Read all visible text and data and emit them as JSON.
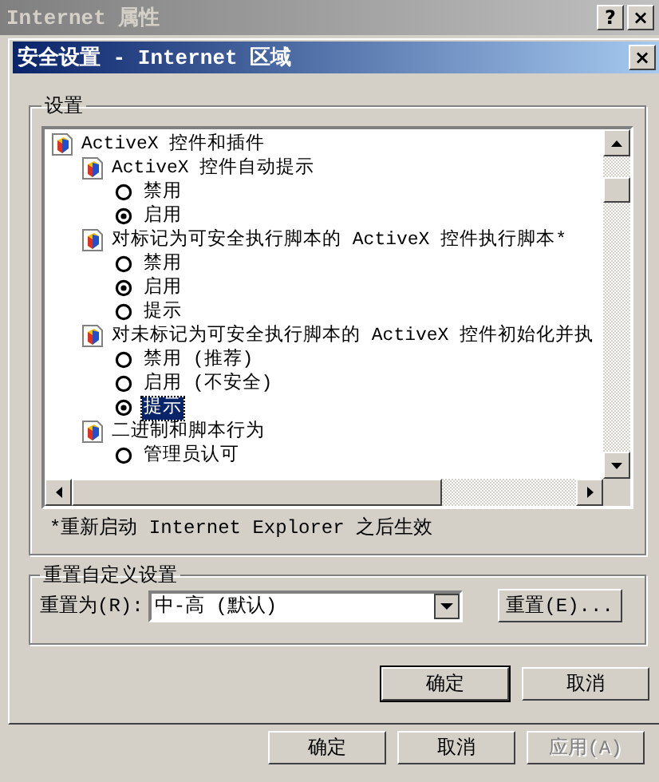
{
  "back_window": {
    "title": "Internet 属性",
    "title_buttons": [
      "?",
      "×"
    ],
    "buttons": [
      {
        "label": "确定",
        "disabled": false
      },
      {
        "label": "取消",
        "disabled": false
      },
      {
        "label": "应用(A)",
        "disabled": true
      }
    ]
  },
  "dialog": {
    "title": "安全设置 - Internet 区域",
    "close": "×"
  },
  "settings": {
    "legend": "设置",
    "tree": [
      {
        "kind": "group",
        "label": "ActiveX 控件和插件",
        "children": [
          {
            "kind": "group",
            "label": "ActiveX 控件自动提示",
            "children": [
              {
                "kind": "radio",
                "label": "禁用",
                "checked": false,
                "selected": false
              },
              {
                "kind": "radio",
                "label": "启用",
                "checked": true,
                "selected": false
              }
            ]
          },
          {
            "kind": "group",
            "label": "对标记为可安全执行脚本的 ActiveX 控件执行脚本*",
            "children": [
              {
                "kind": "radio",
                "label": "禁用",
                "checked": false,
                "selected": false
              },
              {
                "kind": "radio",
                "label": "启用",
                "checked": true,
                "selected": false
              },
              {
                "kind": "radio",
                "label": "提示",
                "checked": false,
                "selected": false
              }
            ]
          },
          {
            "kind": "group",
            "label": "对未标记为可安全执行脚本的 ActiveX 控件初始化并执",
            "children": [
              {
                "kind": "radio",
                "label": "禁用 (推荐)",
                "checked": false,
                "selected": false
              },
              {
                "kind": "radio",
                "label": "启用 (不安全)",
                "checked": false,
                "selected": false
              },
              {
                "kind": "radio",
                "label": "提示",
                "checked": true,
                "selected": true
              }
            ]
          },
          {
            "kind": "group",
            "label": "二进制和脚本行为",
            "children": [
              {
                "kind": "radio",
                "label": "管理员认可",
                "checked": false,
                "selected": false
              }
            ]
          }
        ]
      }
    ],
    "note": "*重新启动 Internet Explorer 之后生效"
  },
  "reset": {
    "legend": "重置自定义设置",
    "label": "重置为(R):",
    "value": "中-高 (默认)",
    "button": "重置(E)..."
  },
  "buttons": [
    {
      "label": "确定",
      "default": true
    },
    {
      "label": "取消",
      "default": false
    }
  ]
}
